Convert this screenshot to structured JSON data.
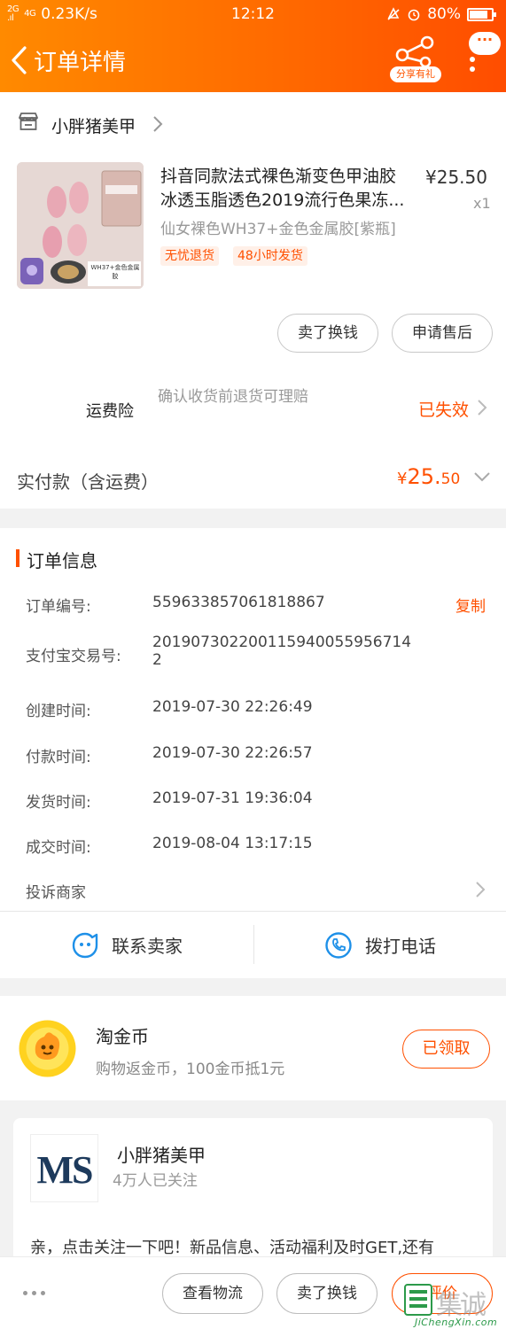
{
  "status_bar": {
    "network": "4G",
    "speed": "0.23K/s",
    "time": "12:12",
    "battery": "80%"
  },
  "nav": {
    "title": "订单详情",
    "share_label": "分享有礼",
    "more_label": "···"
  },
  "shop": {
    "name": "小胖猪美甲"
  },
  "product": {
    "title_line1": "抖音同款法式裸色渐变色甲油胶",
    "title_line2": "冰透玉脂透色2019流行色果冻...",
    "price": "¥25.50",
    "quantity": "x1",
    "sku": "仙女裸色WH37+金色金属胶[紫瓶]",
    "tags": [
      "无忧退货",
      "48小时发货"
    ],
    "image_caption": "WH37+金色金属胶"
  },
  "actions": {
    "resell": "卖了换钱",
    "after_sale": "申请售后"
  },
  "insurance": {
    "label": "运费险",
    "description": "确认收货前退货可理赔",
    "status": "已失效"
  },
  "payment": {
    "label": "实付款（含运费）",
    "currency": "¥",
    "amount_int": "25.",
    "amount_dec": "50"
  },
  "order_info": {
    "title": "订单信息",
    "copy_label": "复制",
    "rows": [
      {
        "label": "订单编号:",
        "value": "559633857061818867"
      },
      {
        "label": "支付宝交易号:",
        "value": "2019073022001159400559567142"
      },
      {
        "label": "创建时间:",
        "value": "2019-07-30 22:26:49"
      },
      {
        "label": "付款时间:",
        "value": "2019-07-30 22:26:57"
      },
      {
        "label": "发货时间:",
        "value": "2019-07-31 19:36:04"
      },
      {
        "label": "成交时间:",
        "value": "2019-08-04 13:17:15"
      }
    ],
    "complain": "投诉商家"
  },
  "contact": {
    "seller": "联系卖家",
    "phone": "拨打电话"
  },
  "coins": {
    "title": "淘金币",
    "description": "购物返金币，100金币抵1元",
    "button": "已领取"
  },
  "shop_card": {
    "logo_text": "MS",
    "name": "小胖猪美甲",
    "followers": "4万人已关注",
    "promo": "亲，点击关注一下吧！新品信息、活动福利及时GET,还有"
  },
  "bottom_bar": {
    "logistics": "查看物流",
    "resell": "卖了换钱",
    "review": "评价"
  },
  "watermark": {
    "text": "集诚信",
    "url_text": "JiChengXin.com"
  },
  "colors": {
    "accent": "#ff5000",
    "header_start": "#ff8a00",
    "header_end": "#ff4d00"
  }
}
